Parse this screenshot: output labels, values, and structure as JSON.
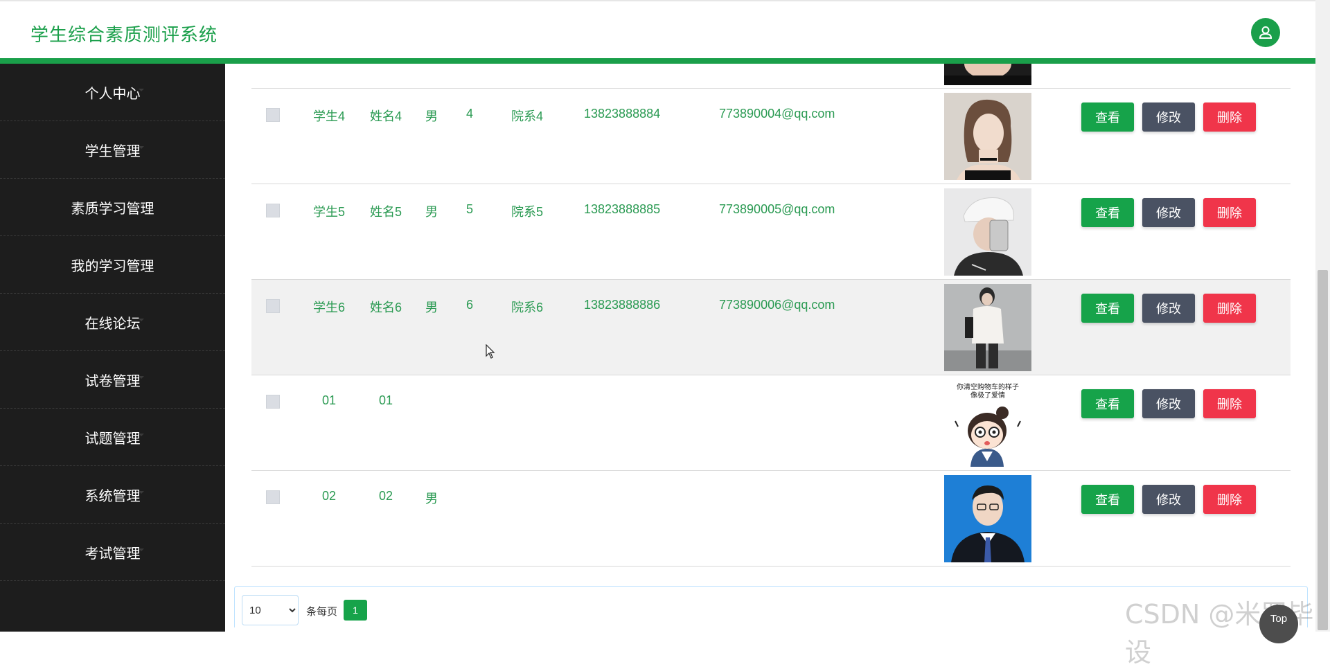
{
  "header": {
    "title": "学生综合素质测评系统",
    "user_icon": "user-icon",
    "accent": "#1a9f4a"
  },
  "sidebar": {
    "items": [
      {
        "label": "个人中心"
      },
      {
        "label": "学生管理"
      },
      {
        "label": "素质学习管理"
      },
      {
        "label": "我的学习管理"
      },
      {
        "label": "在线论坛"
      },
      {
        "label": "试卷管理"
      },
      {
        "label": "试题管理"
      },
      {
        "label": "系统管理"
      },
      {
        "label": "考试管理"
      }
    ]
  },
  "table": {
    "rows": [
      {
        "xuehao": "学生4",
        "xingming": "姓名4",
        "xingbie": "男",
        "nianling": "4",
        "yuanxi": "院系4",
        "shouji": "13823888884",
        "youxiang": "773890004@qq.com",
        "photo": "woman-portrait"
      },
      {
        "xuehao": "学生5",
        "xingming": "姓名5",
        "xingbie": "男",
        "nianling": "5",
        "yuanxi": "院系5",
        "shouji": "13823888885",
        "youxiang": "773890005@qq.com",
        "photo": "person-selfie-cap"
      },
      {
        "xuehao": "学生6",
        "xingming": "姓名6",
        "xingbie": "男",
        "nianling": "6",
        "yuanxi": "院系6",
        "shouji": "13823888886",
        "youxiang": "773890006@qq.com",
        "photo": "man-full-body"
      },
      {
        "xuehao": "01",
        "xingming": "01",
        "xingbie": "",
        "nianling": "",
        "yuanxi": "",
        "shouji": "",
        "youxiang": "",
        "photo": "cartoon-girl-meme",
        "photo_caption_1": "你清空购物车的样子",
        "photo_caption_2": "像极了爱情"
      },
      {
        "xuehao": "02",
        "xingming": "02",
        "xingbie": "男",
        "nianling": "",
        "yuanxi": "",
        "shouji": "",
        "youxiang": "",
        "photo": "id-photo-man"
      }
    ],
    "buttons": {
      "view": "查看",
      "edit": "修改",
      "delete": "删除"
    }
  },
  "pager": {
    "page_size": "10",
    "page_size_options": [
      "10"
    ],
    "per_page_label": "条每页",
    "current_page": "1"
  },
  "watermark": "CSDN @米罗毕设",
  "top_button": "Top"
}
